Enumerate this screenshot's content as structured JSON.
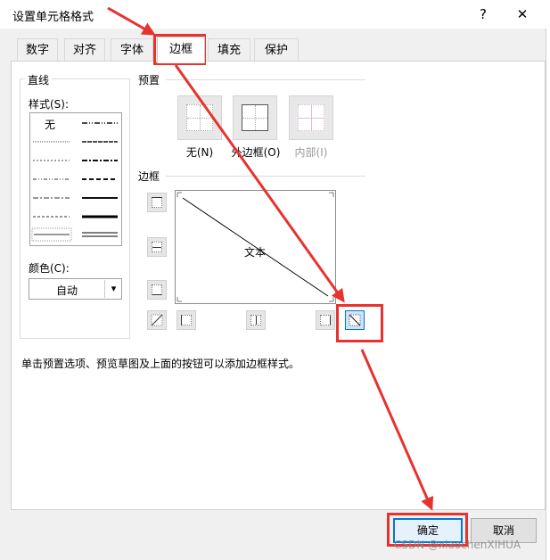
{
  "window": {
    "title": "设置单元格格式",
    "help_label": "?",
    "close_label": "✕"
  },
  "tabs": [
    {
      "label": "数字"
    },
    {
      "label": "对齐"
    },
    {
      "label": "字体"
    },
    {
      "label": "边框",
      "active": true
    },
    {
      "label": "填充"
    },
    {
      "label": "保护"
    }
  ],
  "line_group": {
    "title": "直线",
    "style_label": "样式(S):",
    "none_label": "无",
    "color_label": "颜色(C):",
    "color_value": "自动"
  },
  "presets": {
    "title": "预置",
    "items": [
      {
        "label": "无(N)"
      },
      {
        "label": "外边框(O)"
      },
      {
        "label": "内部(I)",
        "disabled": true
      }
    ]
  },
  "border": {
    "title": "边框",
    "preview_text": "文本"
  },
  "hint": "单击预置选项、预览草图及上面的按钮可以添加边框样式。",
  "buttons": {
    "ok": "确定",
    "cancel": "取消"
  },
  "watermark": "CSDN @xiaochenXIHUA",
  "colors": {
    "annotation": "#e8322f",
    "focus": "#0078d7"
  }
}
